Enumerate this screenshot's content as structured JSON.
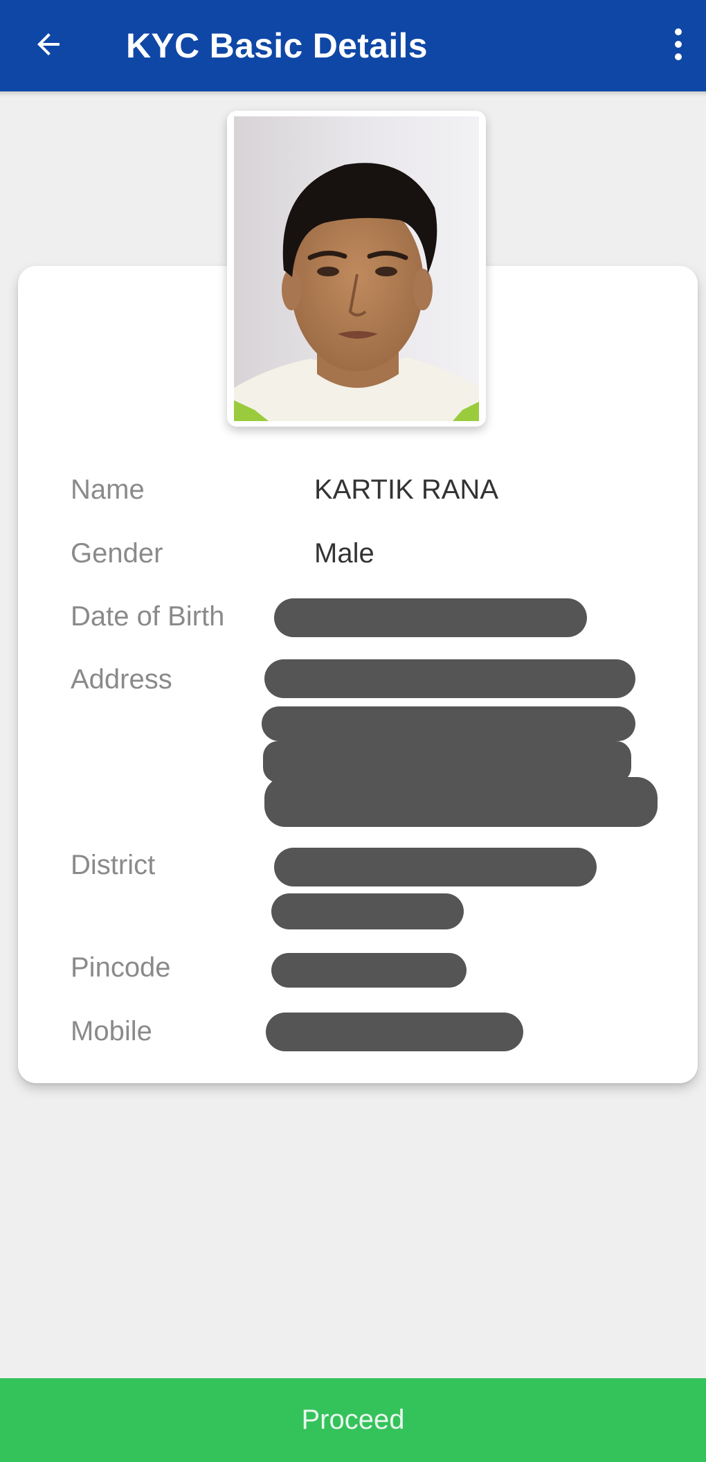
{
  "header": {
    "title": "KYC Basic Details",
    "back_icon": "arrow-left-icon",
    "menu_icon": "more-vertical-icon",
    "color": "#0f47a6"
  },
  "profile": {
    "photo": "applicant-photo"
  },
  "details": {
    "name": {
      "label": "Name",
      "value": "KARTIK RANA"
    },
    "gender": {
      "label": "Gender",
      "value": "Male"
    },
    "dob": {
      "label": "Date of Birth"
    },
    "address": {
      "label": "Address"
    },
    "district": {
      "label": "District"
    },
    "pincode": {
      "label": "Pincode"
    },
    "mobile": {
      "label": "Mobile"
    }
  },
  "footer": {
    "proceed_label": "Proceed",
    "color": "#34c25a"
  }
}
